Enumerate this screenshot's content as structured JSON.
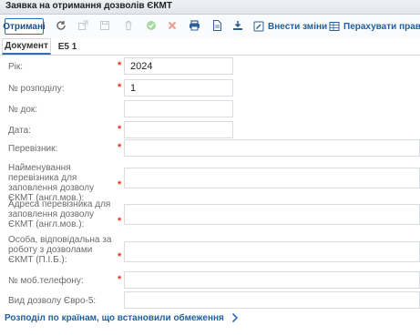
{
  "window": {
    "title": "Заявка на отримання дозволів ЄКМТ"
  },
  "toolbar": {
    "primary_label": "Отримані",
    "apply_changes_label": "Внести зміни",
    "recalc_rights_label": "Перахувати права"
  },
  "tabs": [
    {
      "label": "Документ"
    },
    {
      "label": "Е5 1"
    }
  ],
  "form": {
    "year": {
      "label": "Рік:",
      "value": "2024"
    },
    "order_no": {
      "label": "№ розподілу:",
      "value": "1"
    },
    "doc_no": {
      "label": "№ док:",
      "value": ""
    },
    "date": {
      "label": "Дата:",
      "value": ""
    },
    "carrier": {
      "label": "Перевізник:",
      "value": ""
    },
    "carrier_name_en": {
      "label": "Найменування перевізника для заповлення дозволу ЄКМТ (англ.мов.):",
      "value": ""
    },
    "carrier_address_en": {
      "label": "Адреса перевізника для заповлення дозволу ЄКМТ (англ.мов.):",
      "value": ""
    },
    "responsible_person": {
      "label": "Особа, відповідальна за роботу з дозволами ЄКМТ (П.І.Б.):",
      "value": ""
    },
    "mobile_phone": {
      "label": "№ моб.телефону:",
      "value": ""
    },
    "permit_type": {
      "label": "Вид дозволу Євро-5:",
      "value": ""
    }
  },
  "footer": {
    "link_label": "Розподіл по країнам, що встановили обмеження"
  },
  "colors": {
    "accent": "#2f6fb3",
    "required": "#e0341c",
    "link": "#1f5f9e"
  }
}
